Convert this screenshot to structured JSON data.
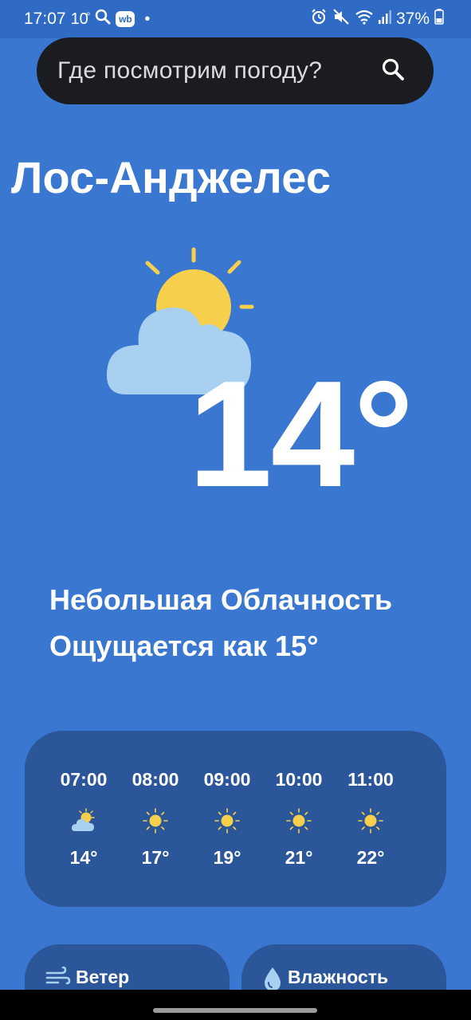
{
  "status_bar": {
    "time": "17:07",
    "weather_small": "10",
    "degree_small": "°",
    "wb_badge": "wb",
    "dot": "•",
    "battery": "37%"
  },
  "search": {
    "placeholder": "Где посмотрим погоду?"
  },
  "city": "Лос-Анджелес",
  "current": {
    "temperature": "14°",
    "condition": "Небольшая Облачность",
    "feels_like": "Ощущается как 15°",
    "icon": "partly-cloudy-icon"
  },
  "hourly": [
    {
      "time": "07:00",
      "temp": "14°",
      "icon": "partly-cloudy-icon"
    },
    {
      "time": "08:00",
      "temp": "17°",
      "icon": "sun-icon"
    },
    {
      "time": "09:00",
      "temp": "19°",
      "icon": "sun-icon"
    },
    {
      "time": "10:00",
      "temp": "21°",
      "icon": "sun-icon"
    },
    {
      "time": "11:00",
      "temp": "22°",
      "icon": "sun-icon"
    }
  ],
  "cards": {
    "wind_label": "Ветер",
    "humidity_label": "Влажность"
  },
  "colors": {
    "background": "#3a77d0",
    "card": "#2b579a",
    "search_bg": "#1a1c20",
    "sun": "#f6d04d",
    "cloud": "#a8d0f0"
  }
}
